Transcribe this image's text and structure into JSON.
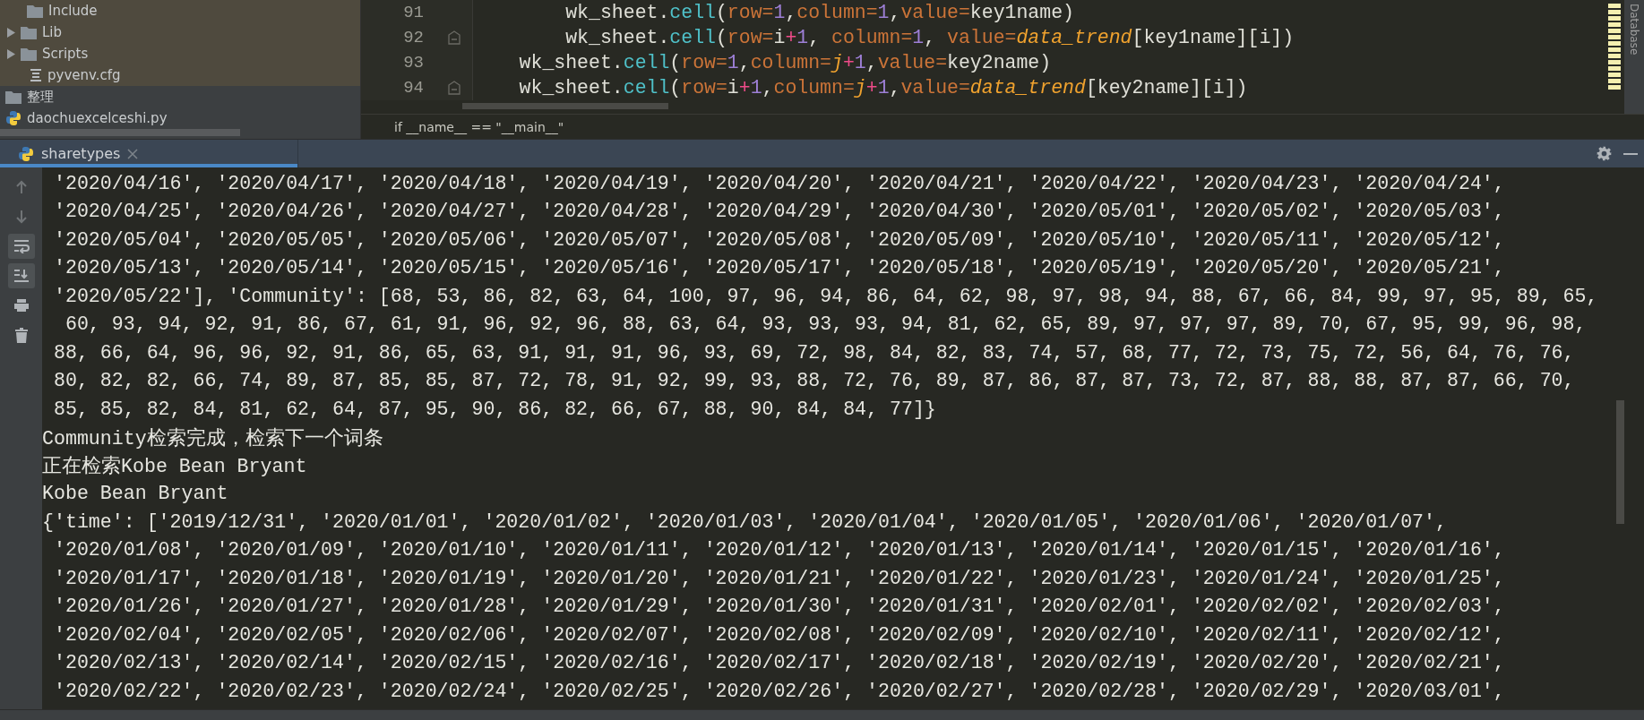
{
  "project_tree": {
    "items": [
      {
        "label": "Include",
        "kind": "folder",
        "highlighted": true
      },
      {
        "label": "Lib",
        "kind": "collapsed-folder",
        "highlighted": true
      },
      {
        "label": "Scripts",
        "kind": "collapsed-folder",
        "highlighted": true
      },
      {
        "label": "pyvenv.cfg",
        "kind": "config-file",
        "highlighted": true
      },
      {
        "label": "整理",
        "kind": "folder",
        "highlighted": false
      },
      {
        "label": "daochuexcelceshi.py",
        "kind": "python-file",
        "highlighted": false
      }
    ]
  },
  "editor": {
    "lines": [
      {
        "number": "91",
        "fold_marker": false,
        "tokens": [
          {
            "kind": "plain",
            "text": "        wk_sheet."
          },
          {
            "kind": "method",
            "text": "cell"
          },
          {
            "kind": "plain",
            "text": "("
          },
          {
            "kind": "kwarg",
            "text": "row="
          },
          {
            "kind": "number",
            "text": "1"
          },
          {
            "kind": "plain",
            "text": ","
          },
          {
            "kind": "kwarg",
            "text": "column="
          },
          {
            "kind": "number",
            "text": "1"
          },
          {
            "kind": "plain",
            "text": ","
          },
          {
            "kind": "kwarg",
            "text": "value="
          },
          {
            "kind": "plain",
            "text": "key1name)"
          }
        ]
      },
      {
        "number": "92",
        "fold_marker": true,
        "tokens": [
          {
            "kind": "plain",
            "text": "        wk_sheet."
          },
          {
            "kind": "method",
            "text": "cell"
          },
          {
            "kind": "plain",
            "text": "("
          },
          {
            "kind": "kwarg",
            "text": "row="
          },
          {
            "kind": "plain",
            "text": "i"
          },
          {
            "kind": "operator",
            "text": "+"
          },
          {
            "kind": "number",
            "text": "1"
          },
          {
            "kind": "plain",
            "text": ", "
          },
          {
            "kind": "kwarg",
            "text": "column="
          },
          {
            "kind": "number",
            "text": "1"
          },
          {
            "kind": "plain",
            "text": ", "
          },
          {
            "kind": "kwarg",
            "text": "value="
          },
          {
            "kind": "variable",
            "text": "data_trend"
          },
          {
            "kind": "plain",
            "text": "[key1name][i])"
          }
        ]
      },
      {
        "number": "93",
        "fold_marker": false,
        "tokens": [
          {
            "kind": "plain",
            "text": "    wk_sheet."
          },
          {
            "kind": "method",
            "text": "cell"
          },
          {
            "kind": "plain",
            "text": "("
          },
          {
            "kind": "kwarg",
            "text": "row="
          },
          {
            "kind": "number",
            "text": "1"
          },
          {
            "kind": "plain",
            "text": ","
          },
          {
            "kind": "kwarg",
            "text": "column="
          },
          {
            "kind": "variable",
            "text": "j"
          },
          {
            "kind": "operator",
            "text": "+"
          },
          {
            "kind": "number",
            "text": "1"
          },
          {
            "kind": "plain",
            "text": ","
          },
          {
            "kind": "kwarg",
            "text": "value="
          },
          {
            "kind": "plain",
            "text": "key2name)"
          }
        ]
      },
      {
        "number": "94",
        "fold_marker": true,
        "tokens": [
          {
            "kind": "plain",
            "text": "    wk_sheet."
          },
          {
            "kind": "method",
            "text": "cell"
          },
          {
            "kind": "plain",
            "text": "("
          },
          {
            "kind": "kwarg",
            "text": "row="
          },
          {
            "kind": "plain",
            "text": "i"
          },
          {
            "kind": "operator",
            "text": "+"
          },
          {
            "kind": "number",
            "text": "1"
          },
          {
            "kind": "plain",
            "text": ","
          },
          {
            "kind": "kwarg",
            "text": "column="
          },
          {
            "kind": "variable",
            "text": "j"
          },
          {
            "kind": "operator",
            "text": "+"
          },
          {
            "kind": "number",
            "text": "1"
          },
          {
            "kind": "plain",
            "text": ","
          },
          {
            "kind": "kwarg",
            "text": "value="
          },
          {
            "kind": "variable",
            "text": "data_trend"
          },
          {
            "kind": "plain",
            "text": "[key2name][i])"
          }
        ]
      }
    ],
    "breadcrumb": "if __name__ == \"__main__\""
  },
  "right_strip": {
    "label": "Database"
  },
  "run_panel": {
    "tab": {
      "label": "sharetypes",
      "selected": true
    },
    "toolbar": [
      {
        "kind": "up",
        "active": false,
        "disabled": true
      },
      {
        "kind": "down",
        "active": false,
        "disabled": true
      },
      {
        "kind": "soft-wrap",
        "active": true,
        "disabled": false
      },
      {
        "kind": "scroll-end",
        "active": true,
        "disabled": false
      },
      {
        "kind": "print",
        "active": false,
        "disabled": false
      },
      {
        "kind": "trash",
        "active": false,
        "disabled": false
      }
    ],
    "output_lines": [
      " '2020/04/16', '2020/04/17', '2020/04/18', '2020/04/19', '2020/04/20', '2020/04/21', '2020/04/22', '2020/04/23', '2020/04/24',",
      " '2020/04/25', '2020/04/26', '2020/04/27', '2020/04/28', '2020/04/29', '2020/04/30', '2020/05/01', '2020/05/02', '2020/05/03',",
      " '2020/05/04', '2020/05/05', '2020/05/06', '2020/05/07', '2020/05/08', '2020/05/09', '2020/05/10', '2020/05/11', '2020/05/12',",
      " '2020/05/13', '2020/05/14', '2020/05/15', '2020/05/16', '2020/05/17', '2020/05/18', '2020/05/19', '2020/05/20', '2020/05/21',",
      " '2020/05/22'], 'Community': [68, 53, 86, 82, 63, 64, 100, 97, 96, 94, 86, 64, 62, 98, 97, 98, 94, 88, 67, 66, 84, 99, 97, 95, 89, 65,",
      "  60, 93, 94, 92, 91, 86, 67, 61, 91, 96, 92, 96, 88, 63, 64, 93, 93, 93, 94, 81, 62, 65, 89, 97, 97, 97, 89, 70, 67, 95, 99, 96, 98,",
      " 88, 66, 64, 96, 96, 92, 91, 86, 65, 63, 91, 91, 91, 96, 93, 69, 72, 98, 84, 82, 83, 74, 57, 68, 77, 72, 73, 75, 72, 56, 64, 76, 76,",
      " 80, 82, 82, 66, 74, 89, 87, 85, 85, 87, 72, 78, 91, 92, 99, 93, 88, 72, 76, 89, 87, 86, 87, 87, 73, 72, 87, 88, 88, 87, 87, 66, 70,",
      " 85, 85, 82, 84, 81, 62, 64, 87, 95, 90, 86, 82, 66, 67, 88, 90, 84, 84, 77]}",
      "Community检索完成，检索下一个词条",
      "正在检索Kobe Bean Bryant",
      "Kobe Bean Bryant",
      "{'time': ['2019/12/31', '2020/01/01', '2020/01/02', '2020/01/03', '2020/01/04', '2020/01/05', '2020/01/06', '2020/01/07',",
      " '2020/01/08', '2020/01/09', '2020/01/10', '2020/01/11', '2020/01/12', '2020/01/13', '2020/01/14', '2020/01/15', '2020/01/16',",
      " '2020/01/17', '2020/01/18', '2020/01/19', '2020/01/20', '2020/01/21', '2020/01/22', '2020/01/23', '2020/01/24', '2020/01/25',",
      " '2020/01/26', '2020/01/27', '2020/01/28', '2020/01/29', '2020/01/30', '2020/01/31', '2020/02/01', '2020/02/02', '2020/02/03',",
      " '2020/02/04', '2020/02/05', '2020/02/06', '2020/02/07', '2020/02/08', '2020/02/09', '2020/02/10', '2020/02/11', '2020/02/12',",
      " '2020/02/13', '2020/02/14', '2020/02/15', '2020/02/16', '2020/02/17', '2020/02/18', '2020/02/19', '2020/02/20', '2020/02/21',",
      " '2020/02/22', '2020/02/23', '2020/02/24', '2020/02/25', '2020/02/26', '2020/02/27', '2020/02/28', '2020/02/29', '2020/03/01',"
    ]
  }
}
